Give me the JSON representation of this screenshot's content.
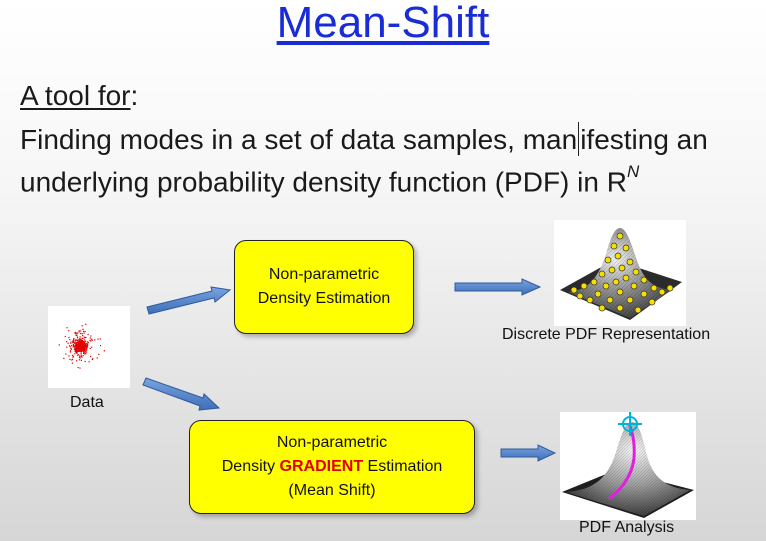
{
  "slide": {
    "title": "Mean-Shift",
    "intro_label": "A tool for",
    "intro_colon": ":",
    "line2_a": "Finding modes in a set of data samples, man",
    "line2_b": "ifesting an",
    "line3_a": "underlying probability density function (PDF) in R",
    "line3_sup": "N"
  },
  "diagram": {
    "data_caption": "Data",
    "box1": {
      "line1": "Non-parametric",
      "line2": "Density Estimation"
    },
    "box2": {
      "line1": "Non-parametric",
      "line2_prefix": "Density ",
      "line2_highlight": "GRADIENT",
      "line2_suffix": " Estimation",
      "line3": "(Mean Shift)"
    },
    "discrete_caption": "Discrete PDF Representation",
    "analysis_caption": "PDF Analysis"
  },
  "colors": {
    "title": "#1a2cd6",
    "box_fill": "#ffff00",
    "highlight": "#e00000",
    "arrow": "#3d6fb8",
    "data_points": "#e00000",
    "path": "#e020e0",
    "target": "#00b4d8"
  },
  "icons": [
    "scatter-plot-image",
    "surface-with-samples-image",
    "surface-with-path-image",
    "crosshair-icon"
  ]
}
